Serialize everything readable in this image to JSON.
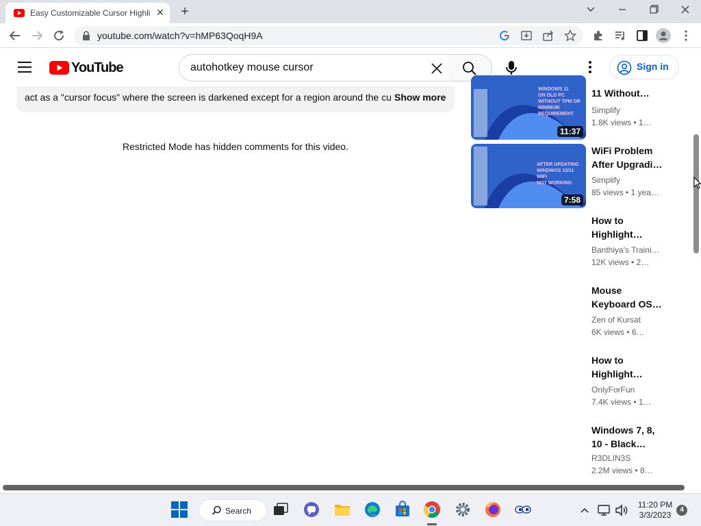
{
  "browser": {
    "tab_title": "Easy Customizable Cursor Highlig",
    "url": "youtube.com/watch?v=hMP63QoqH9A"
  },
  "youtube": {
    "logo_text": "YouTube",
    "search_value": "autohotkey mouse cursor",
    "sign_in_label": "Sign in"
  },
  "description": {
    "text": "act as a \"cursor focus\" where the screen is darkened except for a region around the cur",
    "show_more": "Show more"
  },
  "comments": {
    "notice": "Restricted Mode has hidden comments for this video."
  },
  "recommendations": [
    {
      "title": "11 Without…",
      "channel": "Simplify",
      "meta": "1.8K views  • 1…",
      "duration": "11:37",
      "thumb_text": "WINDOWS 11 ON OLD PC WITHOUT TPM OR MINIMUM REQUIREMENT"
    },
    {
      "title": "WiFi Problem",
      "title2": "After Upgradi…",
      "channel": "Simplify",
      "meta": "85 views  • 1 yea…",
      "duration": "7:58",
      "thumb_text": "AFTER UPDATING WINDOWS 10/11 WIFI NOT WORKING"
    },
    {
      "title": "How to",
      "title2": "Highlight…",
      "channel": "Banthiya's Traini…",
      "meta": "12K views  • 2…"
    },
    {
      "title": "Mouse",
      "title2": "Keyboard OSD…",
      "channel": "Zen of Kursat",
      "meta": "6K views  • 6…"
    },
    {
      "title": "How to",
      "title2": "Highlight…",
      "channel": "OnlyForFun",
      "meta": "7.4K views  • 1…"
    },
    {
      "title": "Windows 7, 8,",
      "title2": "10 - Black…",
      "channel": "R3DLIN3S",
      "meta": "2.2M views  • 8…"
    }
  ],
  "taskbar": {
    "search_label": "Search",
    "time": "11:20 PM",
    "date": "3/3/2023",
    "notifications": "4"
  },
  "colors": {
    "youtube_red": "#ff0000",
    "link_blue": "#065fd4",
    "thumb_bg": "#3a6fd8"
  }
}
